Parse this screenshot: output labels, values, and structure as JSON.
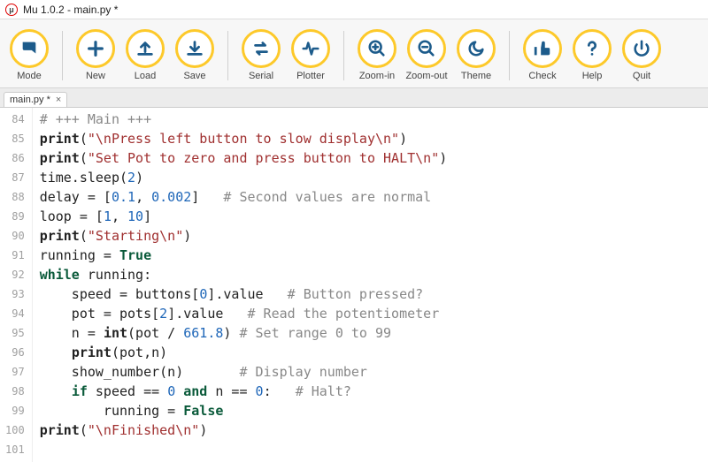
{
  "window": {
    "title": "Mu 1.0.2 - main.py *"
  },
  "toolbar": [
    {
      "name": "mode",
      "label": "Mode",
      "icon": "mode-icon"
    },
    {
      "name": "new",
      "label": "New",
      "icon": "plus-icon"
    },
    {
      "name": "load",
      "label": "Load",
      "icon": "upload-icon"
    },
    {
      "name": "save",
      "label": "Save",
      "icon": "download-icon"
    },
    {
      "name": "serial",
      "label": "Serial",
      "icon": "swap-icon"
    },
    {
      "name": "plotter",
      "label": "Plotter",
      "icon": "pulse-icon"
    },
    {
      "name": "zoom-in",
      "label": "Zoom-in",
      "icon": "zoomin-icon"
    },
    {
      "name": "zoom-out",
      "label": "Zoom-out",
      "icon": "zoomout-icon"
    },
    {
      "name": "theme",
      "label": "Theme",
      "icon": "moon-icon"
    },
    {
      "name": "check",
      "label": "Check",
      "icon": "thumb-icon"
    },
    {
      "name": "help",
      "label": "Help",
      "icon": "question-icon"
    },
    {
      "name": "quit",
      "label": "Quit",
      "icon": "power-icon"
    }
  ],
  "group_breaks": [
    1,
    4,
    6,
    9,
    12
  ],
  "tab": {
    "label": "main.py *",
    "close": "×"
  },
  "editor": {
    "first_line": 84,
    "tokens": [
      [
        [
          "c-comment",
          "# +++ Main +++"
        ]
      ],
      [
        [
          "c-func",
          "print"
        ],
        [
          "",
          "("
        ],
        [
          "c-str",
          "\"\\nPress left button to slow display\\n\""
        ],
        [
          "",
          ")"
        ]
      ],
      [
        [
          "c-func",
          "print"
        ],
        [
          "",
          "("
        ],
        [
          "c-str",
          "\"Set Pot to zero and press button to HALT\\n\""
        ],
        [
          "",
          ")"
        ]
      ],
      [
        [
          "",
          "time.sleep("
        ],
        [
          "c-num",
          "2"
        ],
        [
          "",
          ")"
        ]
      ],
      [
        [
          "",
          "delay = ["
        ],
        [
          "c-num",
          "0.1"
        ],
        [
          "",
          ", "
        ],
        [
          "c-num",
          "0.002"
        ],
        [
          "",
          "]   "
        ],
        [
          "c-comment",
          "# Second values are normal"
        ]
      ],
      [
        [
          "",
          "loop = ["
        ],
        [
          "c-num",
          "1"
        ],
        [
          "",
          ", "
        ],
        [
          "c-num",
          "10"
        ],
        [
          "",
          "]"
        ]
      ],
      [
        [
          "c-func",
          "print"
        ],
        [
          "",
          "("
        ],
        [
          "c-str",
          "\"Starting\\n\""
        ],
        [
          "",
          ")"
        ]
      ],
      [
        [
          "",
          "running = "
        ],
        [
          "c-kw",
          "True"
        ]
      ],
      [
        [
          "c-kw",
          "while"
        ],
        [
          "",
          " running:"
        ]
      ],
      [
        [
          "",
          "    speed = buttons["
        ],
        [
          "c-num",
          "0"
        ],
        [
          "",
          "].value   "
        ],
        [
          "c-comment",
          "# Button pressed?"
        ]
      ],
      [
        [
          "",
          "    pot = pots["
        ],
        [
          "c-num",
          "2"
        ],
        [
          "",
          "].value   "
        ],
        [
          "c-comment",
          "# Read the potentiometer"
        ]
      ],
      [
        [
          "",
          "    n = "
        ],
        [
          "c-func",
          "int"
        ],
        [
          "",
          "(pot / "
        ],
        [
          "c-num",
          "661.8"
        ],
        [
          "",
          ") "
        ],
        [
          "c-comment",
          "# Set range 0 to 99"
        ]
      ],
      [
        [
          "",
          "    "
        ],
        [
          "c-func",
          "print"
        ],
        [
          "",
          "(pot,n)"
        ]
      ],
      [
        [
          "",
          "    show_number(n)       "
        ],
        [
          "c-comment",
          "# Display number"
        ]
      ],
      [
        [
          "",
          "    "
        ],
        [
          "c-kw",
          "if"
        ],
        [
          "",
          " speed == "
        ],
        [
          "c-num",
          "0"
        ],
        [
          "",
          " "
        ],
        [
          "c-kw",
          "and"
        ],
        [
          "",
          " n == "
        ],
        [
          "c-num",
          "0"
        ],
        [
          "",
          ":   "
        ],
        [
          "c-comment",
          "# Halt?"
        ]
      ],
      [
        [
          "",
          "        running = "
        ],
        [
          "c-kw",
          "False"
        ]
      ],
      [
        [
          "c-func",
          "print"
        ],
        [
          "",
          "("
        ],
        [
          "c-str",
          "\"\\nFinished\\n\""
        ],
        [
          "",
          ")"
        ]
      ],
      [
        [
          "",
          ""
        ]
      ]
    ]
  },
  "icons": {
    "mode-icon": "<svg width='22' height='22' viewBox='0 0 24 24' fill='#1c5b8b'><path d='M4 4h14a2 2 0 0 1 2 2v12l-5-4H6a2 2 0 0 1-2-2z'/></svg>",
    "plus-icon": "<svg width='22' height='22' viewBox='0 0 24 24' fill='none' stroke='#1c5b8b' stroke-width='3.5' stroke-linecap='round'><path d='M12 4v16M4 12h16'/></svg>",
    "upload-icon": "<svg width='22' height='22' viewBox='0 0 24 24' fill='none' stroke='#1c5b8b' stroke-width='3' stroke-linecap='round' stroke-linejoin='round'><path d='M12 16V5M7 10l5-5 5 5M4 19h16'/></svg>",
    "download-icon": "<svg width='22' height='22' viewBox='0 0 24 24' fill='none' stroke='#1c5b8b' stroke-width='3' stroke-linecap='round' stroke-linejoin='round'><path d='M12 4v11M7 10l5 5 5-5M4 19h16'/></svg>",
    "swap-icon": "<svg width='22' height='22' viewBox='0 0 24 24' fill='none' stroke='#1c5b8b' stroke-width='3' stroke-linecap='round' stroke-linejoin='round'><path d='M5 8h12l-3-3M19 16H7l3 3'/></svg>",
    "pulse-icon": "<svg width='22' height='22' viewBox='0 0 24 24' fill='none' stroke='#1c5b8b' stroke-width='2.8' stroke-linecap='round' stroke-linejoin='round'><path d='M3 12h4l2-7 4 14 2-7h6'/></svg>",
    "zoomin-icon": "<svg width='22' height='22' viewBox='0 0 24 24' fill='none' stroke='#1c5b8b' stroke-width='2.8' stroke-linecap='round'><circle cx='10' cy='10' r='7'/><path d='M20 20l-5-5M10 7v6M7 10h6'/></svg>",
    "zoomout-icon": "<svg width='22' height='22' viewBox='0 0 24 24' fill='none' stroke='#1c5b8b' stroke-width='2.8' stroke-linecap='round'><circle cx='10' cy='10' r='7'/><path d='M20 20l-5-5M7 10h6'/></svg>",
    "moon-icon": "<svg width='22' height='22' viewBox='0 0 24 24' fill='none' stroke='#1c5b8b' stroke-width='2.8' stroke-linecap='round' stroke-linejoin='round'><path d='M20 13A8 8 0 1 1 11 4a6 6 0 0 0 9 9z'/></svg>",
    "thumb-icon": "<svg width='22' height='22' viewBox='0 0 24 24' fill='#1c5b8b'><path d='M2 20h3V10H2v10zm18-9h-5V5a2 2 0 0 0-4 0l-1 6v9h9a2 2 0 0 0 2-2v-5a2 2 0 0 0-1-2z'/></svg>",
    "question-icon": "<svg width='22' height='22' viewBox='0 0 24 24' fill='none' stroke='#1c5b8b' stroke-width='3' stroke-linecap='round' stroke-linejoin='round'><path d='M8 8a4 4 0 1 1 5 4c-1 .4-1 1-1 2'/><circle cx='12' cy='19' r='1.5' fill='#1c5b8b' stroke='none'/></svg>",
    "power-icon": "<svg width='22' height='22' viewBox='0 0 24 24' fill='none' stroke='#1c5b8b' stroke-width='2.8' stroke-linecap='round'><path d='M12 3v9M6 7a8 8 0 1 0 12 0'/></svg>"
  }
}
